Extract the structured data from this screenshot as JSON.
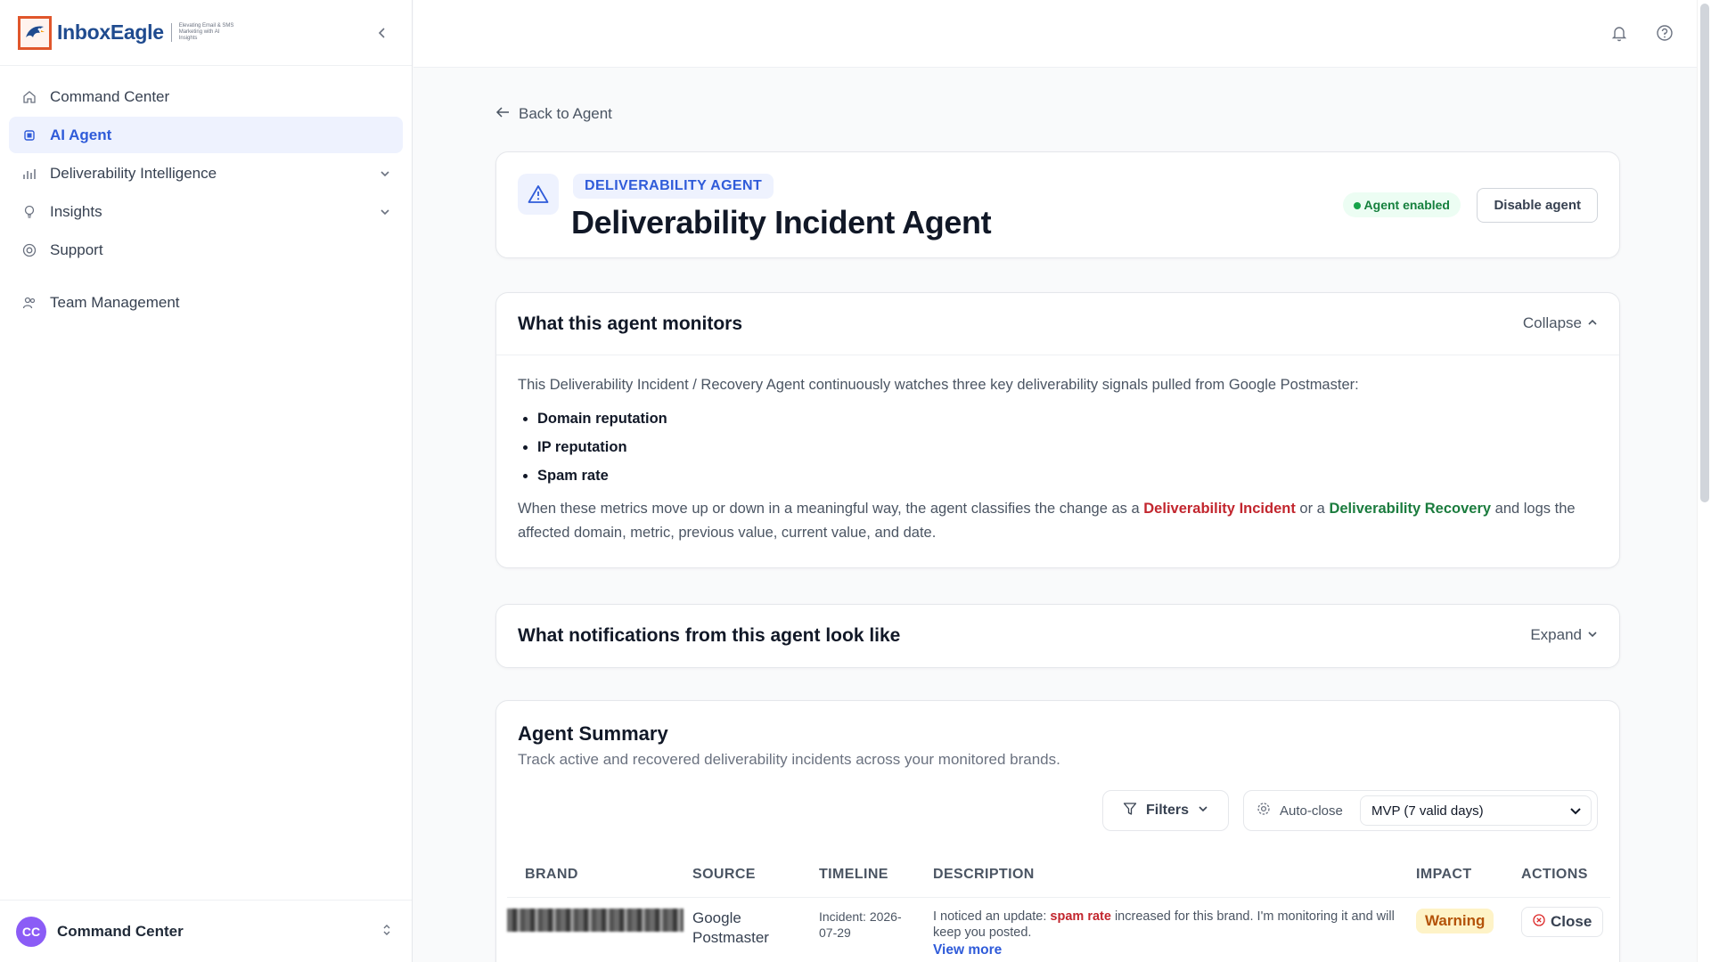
{
  "brand": {
    "name": "InboxEagle",
    "tagline": "Elevating Email & SMS Marketing with AI Insights",
    "collapse_icon": "chevron-left-icon"
  },
  "sidebar": {
    "items": [
      {
        "label": "Command Center",
        "icon": "home-icon",
        "active": false
      },
      {
        "label": "AI Agent",
        "icon": "chip-icon",
        "active": true
      },
      {
        "label": "Deliverability Intelligence",
        "icon": "bar-chart-icon",
        "active": false,
        "expandable": true
      },
      {
        "label": "Insights",
        "icon": "lightbulb-icon",
        "active": false,
        "expandable": true
      },
      {
        "label": "Support",
        "icon": "lifebuoy-icon",
        "active": false
      }
    ],
    "team_item": {
      "label": "Team Management",
      "icon": "users-icon"
    },
    "footer": {
      "avatar": "CC",
      "label": "Command Center"
    }
  },
  "topbar": {
    "icons": [
      "bell-icon",
      "help-icon"
    ]
  },
  "page": {
    "back_label": "Back to Agent",
    "agent_category": "DELIVERABILITY AGENT",
    "agent_title": "Deliverability Incident Agent",
    "status_label": "Agent enabled",
    "disable_label": "Disable agent"
  },
  "monitors": {
    "title": "What this agent monitors",
    "toggle_label": "Collapse",
    "intro": "This Deliverability Incident / Recovery Agent continuously watches three key deliverability signals pulled from Google Postmaster:",
    "signals": [
      "Domain reputation",
      "IP reputation",
      "Spam rate"
    ],
    "outro_1": "When these metrics move up or down in a meaningful way, the agent classifies the change as a",
    "incident_term": "Deliverability Incident",
    "or_a": "or a",
    "recovery_term": "Deliverability Recovery",
    "outro_2": "and logs the affected domain, metric, previous value, current value, and date."
  },
  "notifications": {
    "title": "What notifications from this agent look like",
    "toggle_label": "Expand"
  },
  "summary": {
    "title": "Agent Summary",
    "subtitle": "Track active and recovered deliverability incidents across your monitored brands.",
    "filters_label": "Filters",
    "autoclose_label": "Auto-close",
    "autoclose_value": "MVP (7 valid days)",
    "columns": [
      "BRAND",
      "SOURCE",
      "TIMELINE",
      "DESCRIPTION",
      "IMPACT",
      "ACTIONS"
    ],
    "rows": [
      {
        "source_line1": "Google",
        "source_line2": "Postmaster",
        "timeline_line1": "Incident: 2026-",
        "timeline_line2": "07-29",
        "desc_pre": "I noticed an update: ",
        "desc_kw": "spam rate",
        "desc_post": " increased for this brand. I'm monitoring it and will keep you posted.",
        "view_more": "View more",
        "impact": "Warning",
        "action": "Close"
      }
    ]
  },
  "colors": {
    "accent": "#2f5bd9",
    "incident": "#c2262e",
    "recovery": "#1b7c3e",
    "warning_bg": "#fef3c7",
    "warning_text": "#b45309"
  }
}
